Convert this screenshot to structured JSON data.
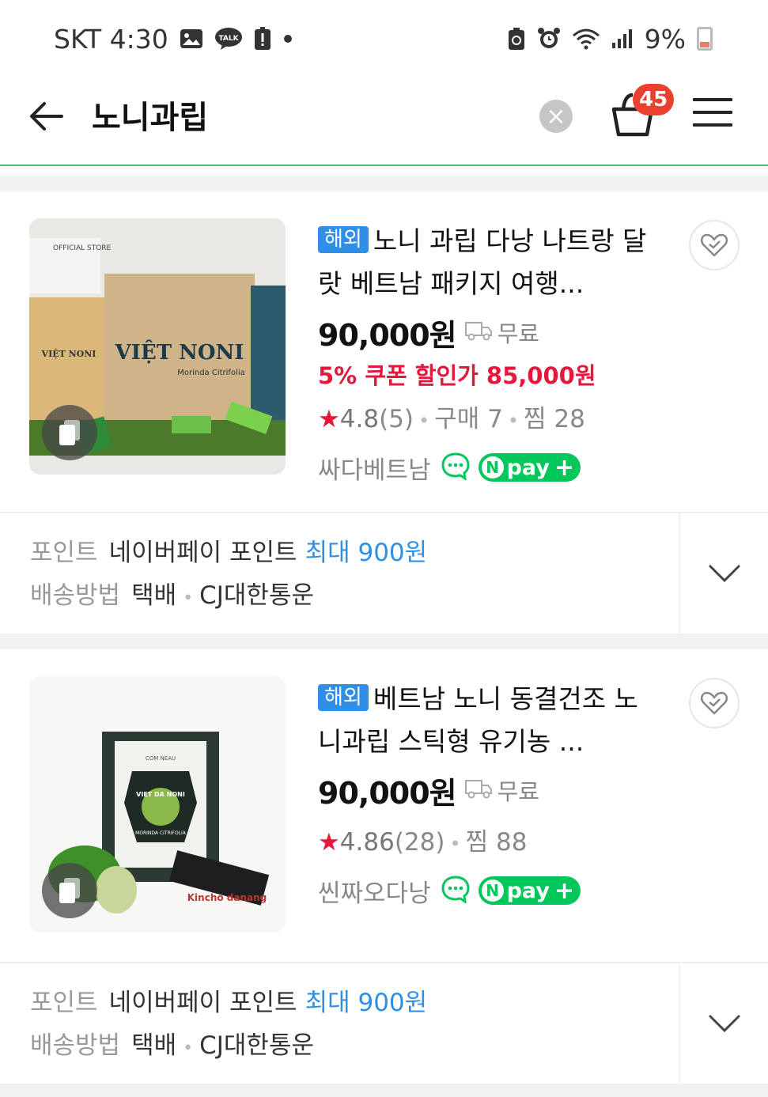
{
  "status_bar": {
    "carrier_time": "SKT 4:30",
    "talk_icon_text": "TALK",
    "battery": "9%"
  },
  "header": {
    "query": "노니과립",
    "cart_count": "45"
  },
  "products": [
    {
      "badge": "해외",
      "title": "노니 과립 다낭 나트랑 달랏 베트남 패키지 여행...",
      "price": "90,000원",
      "shipping": "무료",
      "coupon": "5% 쿠폰 할인가 85,000원",
      "rating": "4.8",
      "review_count": "(5)",
      "purchase": "구매 7",
      "wish": "찜 28",
      "seller": "싸다베트남",
      "npay": "pay",
      "image_labels": {
        "brand": "VIỆT NONI",
        "sub": "Morinda Citrifolia",
        "store": "OFFICIAL STORE"
      },
      "benefit": {
        "point_label": "포인트",
        "point_value": "네이버페이 포인트",
        "point_max": "최대 900원",
        "delivery_label": "배송방법",
        "delivery_value": "택배",
        "courier": "CJ대한통운"
      }
    },
    {
      "badge": "해외",
      "title": "베트남 노니 동결건조 노니과립 스틱형 유기농 ...",
      "price": "90,000원",
      "shipping": "무료",
      "coupon": "",
      "rating": "4.86",
      "review_count": "(28)",
      "purchase": "",
      "wish": "찜 88",
      "seller": "씬짜오다낭",
      "npay": "pay",
      "image_labels": {
        "brand": "VIET DA NONI",
        "sub": "MORINDA CITRIFOLIA",
        "store": "Kincho danang"
      },
      "benefit": {
        "point_label": "포인트",
        "point_value": "네이버페이 포인트",
        "point_max": "최대 900원",
        "delivery_label": "배송방법",
        "delivery_value": "택배",
        "courier": "CJ대한통운"
      }
    }
  ],
  "colors": {
    "accent_green": "#03c75a",
    "coupon_red": "#e4183b",
    "badge_blue": "#2f8fe6"
  }
}
